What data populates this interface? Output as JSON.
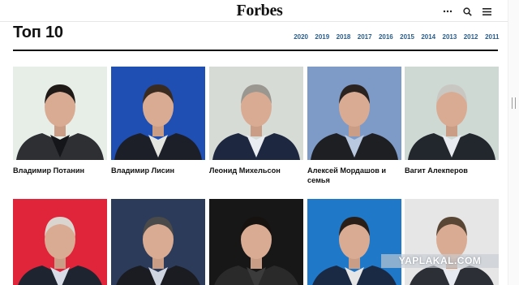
{
  "header": {
    "logo": "Forbes"
  },
  "list": {
    "title": "Топ 10",
    "years": [
      "2020",
      "2019",
      "2018",
      "2017",
      "2016",
      "2015",
      "2014",
      "2013",
      "2012",
      "2011"
    ]
  },
  "people_row1": [
    {
      "name": "Владимир Потанин",
      "bg": "#e7eee8",
      "suit": "#2d2f33",
      "shirt": "#15161a",
      "hair": "#1f1a17"
    },
    {
      "name": "Владимир Лисин",
      "bg": "#1f4fb3",
      "suit": "#1c1f28",
      "shirt": "#e5e5e0",
      "hair": "#3a2b20"
    },
    {
      "name": "Леонид Михельсон",
      "bg": "#d6dbd6",
      "suit": "#1e2740",
      "shirt": "#e9ecf0",
      "hair": "#9a9690"
    },
    {
      "name": "Алексей Мордашов и семья",
      "bg": "#7e9bc7",
      "suit": "#1d1f23",
      "shirt": "#b9c8de",
      "hair": "#2a2320"
    },
    {
      "name": "Вагит Алекперов",
      "bg": "#cfd9d4",
      "suit": "#22262d",
      "shirt": "#e8ebef",
      "hair": "#c9c7c2"
    }
  ],
  "people_row2": [
    {
      "bg": "#e02439",
      "suit": "#1e2430",
      "shirt": "#d7dce6",
      "hair": "#dad6cf"
    },
    {
      "bg": "#2c3b5a",
      "suit": "#1a1c22",
      "shirt": "#cfd6e2",
      "hair": "#4a4a4a"
    },
    {
      "bg": "#171717",
      "suit": "#2a2a2a",
      "shirt": "#3b3b3b",
      "hair": "#161210"
    },
    {
      "bg": "#1f78c8",
      "suit": "#1b2a44",
      "shirt": "#e6e6e6",
      "hair": "#2a1f18"
    },
    {
      "bg": "#e6e6e6",
      "suit": "#2c2f36",
      "shirt": "#e7ebf1",
      "hair": "#5a4634"
    }
  ],
  "watermark": "YAPLAKAL.COM"
}
